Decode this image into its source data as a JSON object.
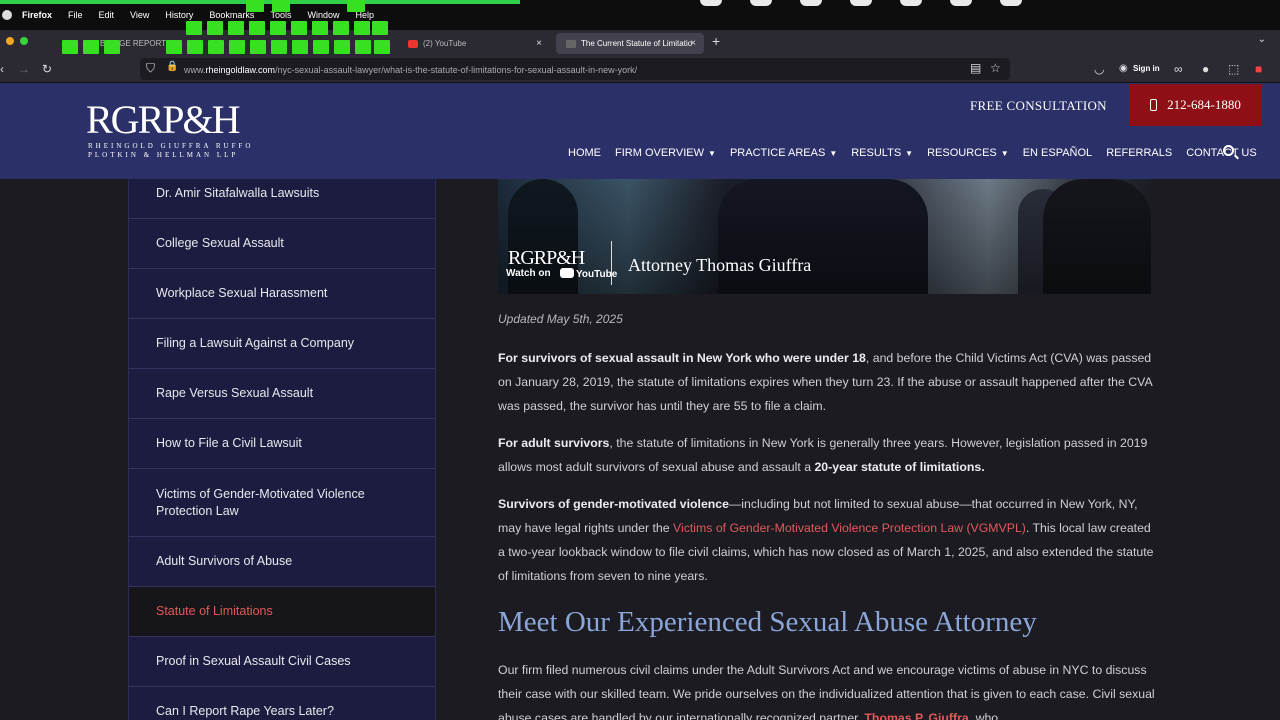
{
  "menubar": {
    "items": [
      "Firefox",
      "File",
      "Edit",
      "View",
      "History",
      "Bookmarks",
      "Tools",
      "Window",
      "Help"
    ]
  },
  "browser": {
    "tabs": [
      {
        "label": "BRIDGE REPORT"
      },
      {
        "label": ""
      },
      {
        "label": "(2) YouTube"
      },
      {
        "label": "The Current Statute of Limitatio"
      }
    ],
    "url_prefix": "www.",
    "url_domain": "rheingoldlaw.com",
    "url_path": "/nyc-sexual-assault-lawyer/what-is-the-statute-of-limitations-for-sexual-assault-in-new-york/",
    "signin_label": "Sign in"
  },
  "site": {
    "logo": "RGRP&H",
    "logo_sub": "RHEINGOLD GIUFFRA RUFFO PLOTKIN & HELLMAN LLP",
    "free_consultation": "FREE CONSULTATION",
    "phone": "212-684-1880",
    "nav": [
      {
        "label": "HOME",
        "caret": false
      },
      {
        "label": "FIRM OVERVIEW",
        "caret": true
      },
      {
        "label": "PRACTICE AREAS",
        "caret": true
      },
      {
        "label": "RESULTS",
        "caret": true
      },
      {
        "label": "RESOURCES",
        "caret": true
      },
      {
        "label": "EN ESPAÑOL",
        "caret": false
      },
      {
        "label": "REFERRALS",
        "caret": false
      },
      {
        "label": "CONTACT US",
        "caret": false
      }
    ]
  },
  "sidebar": {
    "items": [
      {
        "label": "Dr. Amir Sitafalwalla Lawsuits",
        "active": false
      },
      {
        "label": "College Sexual Assault",
        "active": false
      },
      {
        "label": "Workplace Sexual Harassment",
        "active": false
      },
      {
        "label": "Filing a Lawsuit Against a Company",
        "active": false
      },
      {
        "label": "Rape Versus Sexual Assault",
        "active": false
      },
      {
        "label": "How to File a Civil Lawsuit",
        "active": false
      },
      {
        "label": "Victims of Gender-Motivated Violence Protection Law",
        "active": false
      },
      {
        "label": "Adult Survivors of Abuse",
        "active": false
      },
      {
        "label": "Statute of Limitations",
        "active": true
      },
      {
        "label": "Proof in Sexual Assault Civil Cases",
        "active": false
      },
      {
        "label": "Can I Report Rape Years Later?",
        "active": false
      }
    ]
  },
  "video": {
    "logo": "RGRP&H",
    "title": "Attorney Thomas Giuffra",
    "watch_on": "Watch on",
    "youtube": "YouTube"
  },
  "article": {
    "updated": "Updated May 5th, 2025",
    "p1_bold": "For survivors of sexual assault in New York who were under 18",
    "p1_rest": ", and before the Child Victims Act (CVA) was passed on January 28, 2019, the statute of limitations expires when they turn 23. If the abuse or assault happened after the CVA was passed, the survivor has until they are 55 to file a claim.",
    "p2_bold": "For adult survivors",
    "p2_mid": ", the statute of limitations in New York is generally three years. However, legislation passed in 2019 allows most adult survivors of sexual abuse and assault a ",
    "p2_bold2": "20-year statute of limitations.",
    "p3_bold": "Survivors of gender-motivated violence",
    "p3_mid": "—including but not limited to sexual abuse—that occurred in New York, NY, may have legal rights under the ",
    "p3_link": "Victims of Gender-Motivated Violence Protection Law (VGMVPL)",
    "p3_rest": ". This local law created a two-year lookback window to file civil claims, which has now closed as of March 1, 2025, and also extended the statute of limitations from seven to nine years.",
    "heading": "Meet Our Experienced Sexual Abuse Attorney",
    "p4": "Our firm filed numerous civil claims under the Adult Survivors Act and we encourage victims of abuse in NYC to discuss their case with our skilled team. We pride ourselves on the individualized attention that is given to each case. Civil sexual abuse cases are handled by our internationally recognized partner, ",
    "p4_link": "Thomas P. Giuffra",
    "p4_rest": ", who"
  }
}
